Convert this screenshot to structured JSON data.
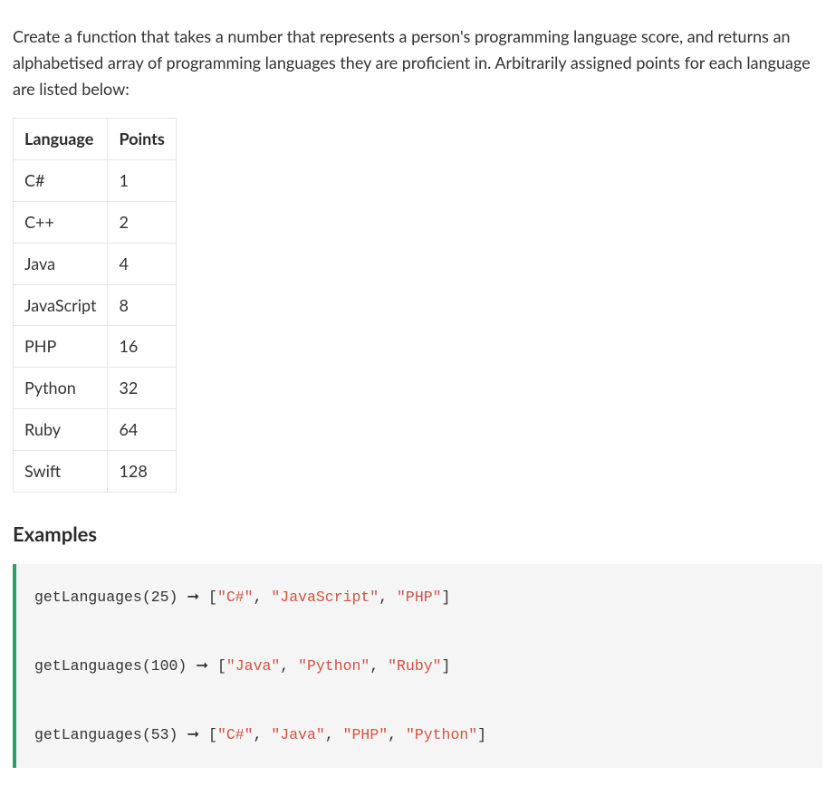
{
  "intro": "Create a function that takes a number that represents a person's programming language score, and returns an alphabetised array of programming languages they are proficient in. Arbitrarily assigned points for each language are listed below:",
  "table": {
    "headers": [
      "Language",
      "Points"
    ],
    "rows": [
      {
        "language": "C#",
        "points": "1"
      },
      {
        "language": "C++",
        "points": "2"
      },
      {
        "language": "Java",
        "points": "4"
      },
      {
        "language": "JavaScript",
        "points": "8"
      },
      {
        "language": "PHP",
        "points": "16"
      },
      {
        "language": "Python",
        "points": "32"
      },
      {
        "language": "Ruby",
        "points": "64"
      },
      {
        "language": "Swift",
        "points": "128"
      }
    ]
  },
  "examples_heading": "Examples",
  "code": {
    "fn": "getLanguages",
    "arrow": "➞",
    "lines": [
      {
        "arg": "25",
        "result_parts": [
          "\"C#\"",
          "\"JavaScript\"",
          "\"PHP\""
        ]
      },
      {
        "arg": "100",
        "result_parts": [
          "\"Java\"",
          "\"Python\"",
          "\"Ruby\""
        ]
      },
      {
        "arg": "53",
        "result_parts": [
          "\"C#\"",
          "\"Java\"",
          "\"PHP\"",
          "\"Python\""
        ]
      }
    ]
  }
}
